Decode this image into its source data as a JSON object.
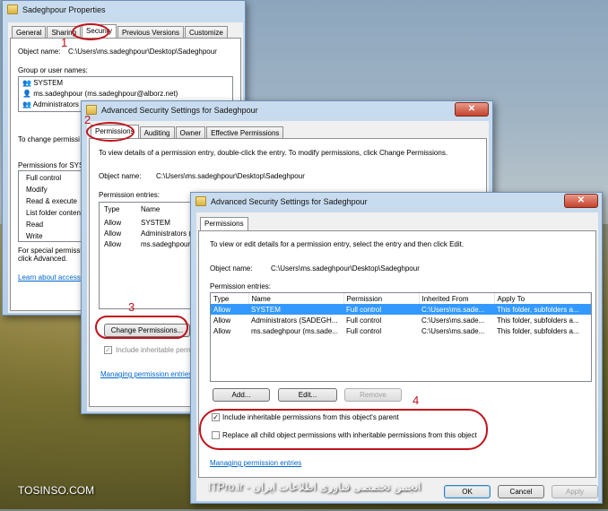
{
  "footer": {
    "brand": "TOSINSO.COM",
    "site_caption": "انجمن تخصصی فناوری اطلاعات ایران - ITPro.ir"
  },
  "annotations": {
    "n1": "1",
    "n2": "2",
    "n3": "3",
    "n4": "4"
  },
  "props_window": {
    "title": "Sadeghpour Properties",
    "tabs": [
      "General",
      "Sharing",
      "Security",
      "Previous Versions",
      "Customize"
    ],
    "object_name_label": "Object name:",
    "object_name_value": "C:\\Users\\ms.sadeghpour\\Desktop\\Sadeghpour",
    "group_label": "Group or user names:",
    "users": [
      "SYSTEM",
      "ms.sadeghpour (ms.sadeghpour@alborz.net)",
      "Administrators"
    ],
    "change_perm_text": "To change permissi",
    "permissions_for": "Permissions for SYS",
    "permission_list": [
      "Full control",
      "Modify",
      "Read & execute",
      "List folder content",
      "Read",
      "Write"
    ],
    "special_text_1": "For special permissio",
    "special_text_2": "click Advanced.",
    "learn_link": "Learn about access"
  },
  "adv1": {
    "title": "Advanced Security Settings for Sadeghpour",
    "tabs": [
      "Permissions",
      "Auditing",
      "Owner",
      "Effective Permissions"
    ],
    "intro": "To view details of a permission entry, double-click the entry. To modify permissions, click Change Permissions.",
    "object_name_label": "Object name:",
    "object_name_value": "C:\\Users\\ms.sadeghpour\\Desktop\\Sadeghpour",
    "entries_label": "Permission entries:",
    "col_type": "Type",
    "col_name": "Name",
    "rows": [
      {
        "type": "Allow",
        "name": "SYSTEM"
      },
      {
        "type": "Allow",
        "name": "Administrators (S"
      },
      {
        "type": "Allow",
        "name": "ms.sadeghpour (m"
      }
    ],
    "change_button": "Change Permissions...",
    "include_text": "Include inheritable permissi",
    "manage_link": "Managing permission entries"
  },
  "adv2": {
    "title": "Advanced Security Settings for Sadeghpour",
    "tab": "Permissions",
    "intro": "To view or edit details for a permission entry, select the entry and then click Edit.",
    "object_name_label": "Object name:",
    "object_name_value": "C:\\Users\\ms.sadeghpour\\Desktop\\Sadeghpour",
    "entries_label": "Permission entries:",
    "columns": [
      "Type",
      "Name",
      "Permission",
      "Inherited From",
      "Apply To"
    ],
    "rows": [
      {
        "type": "Allow",
        "name": "SYSTEM",
        "permission": "Full control",
        "inherited": "C:\\Users\\ms.sade...",
        "apply": "This folder, subfolders a..."
      },
      {
        "type": "Allow",
        "name": "Administrators (SADEGH...",
        "permission": "Full control",
        "inherited": "C:\\Users\\ms.sade...",
        "apply": "This folder, subfolders a..."
      },
      {
        "type": "Allow",
        "name": "ms.sadeghpour (ms.sade...",
        "permission": "Full control",
        "inherited": "C:\\Users\\ms.sade...",
        "apply": "This folder, subfolders a..."
      }
    ],
    "add_button": "Add...",
    "edit_button": "Edit...",
    "remove_button": "Remove",
    "include_check": "Include inheritable permissions from this object's parent",
    "include_checked": true,
    "replace_check": "Replace all child object permissions with inheritable permissions from this object",
    "replace_checked": false,
    "manage_link": "Managing permission entries",
    "ok_button": "OK",
    "cancel_button": "Cancel",
    "apply_button": "Apply"
  }
}
